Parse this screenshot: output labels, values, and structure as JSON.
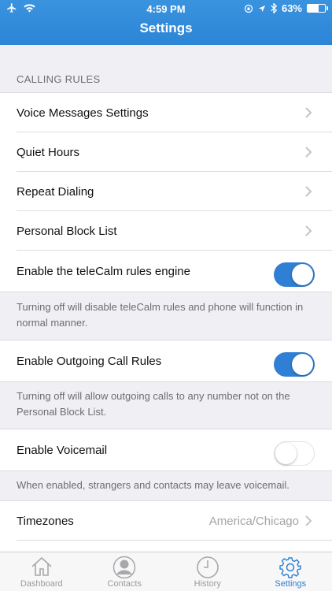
{
  "status": {
    "time": "4:59 PM",
    "battery": "63%",
    "battery_level": 0.63
  },
  "nav": {
    "title": "Settings"
  },
  "section": {
    "header": "CALLING RULES"
  },
  "rows": {
    "voice_messages": "Voice Messages Settings",
    "quiet_hours": "Quiet Hours",
    "repeat_dialing": "Repeat Dialing",
    "personal_block_list": "Personal Block List",
    "rules_engine": "Enable the teleCalm rules engine",
    "outgoing_rules": "Enable Outgoing Call Rules",
    "voicemail": "Enable Voicemail",
    "timezones": "Timezones",
    "timezones_value": "America/Chicago"
  },
  "toggles": {
    "rules_engine": true,
    "outgoing_rules": true,
    "voicemail": false
  },
  "footnotes": {
    "rules_engine": "Turning off will disable teleCalm rules and phone will function in normal manner.",
    "outgoing_rules": "Turning off will allow outgoing calls to any number not on the Personal Block List.",
    "voicemail": "When enabled, strangers and contacts may leave voicemail."
  },
  "tabs": [
    {
      "label": "Dashboard",
      "icon": "home-icon"
    },
    {
      "label": "Contacts",
      "icon": "person-icon"
    },
    {
      "label": "History",
      "icon": "clock-icon"
    },
    {
      "label": "Settings",
      "icon": "gear-icon"
    }
  ],
  "colors": {
    "accent": "#2f7fd4",
    "header": "#2c85d6",
    "background": "#efeff4"
  }
}
